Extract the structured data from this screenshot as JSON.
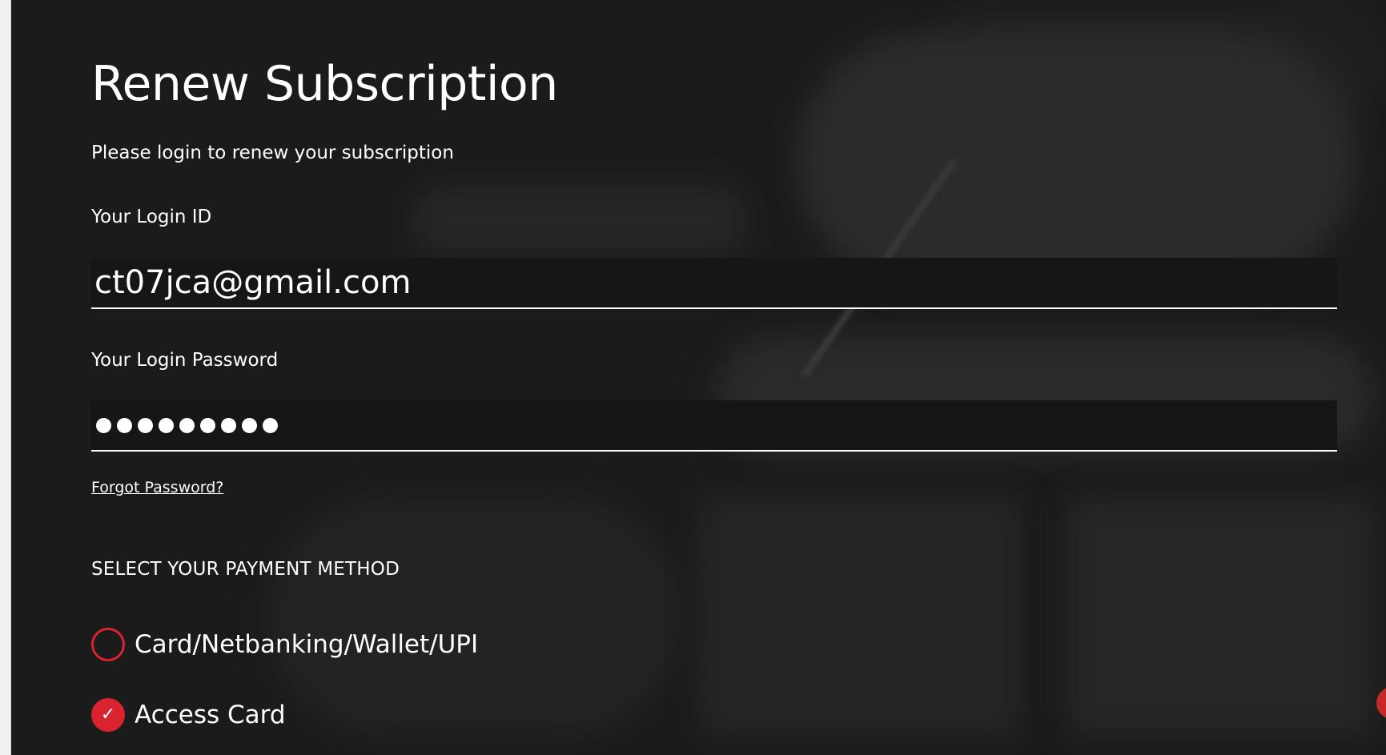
{
  "page": {
    "title": "Renew Subscription",
    "subtitle": "Please login to renew your subscription"
  },
  "login_form": {
    "login_id_label": "Your Login ID",
    "login_id_value": "ct07jca@gmail.com",
    "password_label": "Your Login Password",
    "password_masked_length": 9,
    "forgot_password_link": "Forgot Password?"
  },
  "payment": {
    "heading": "SELECT YOUR PAYMENT METHOD",
    "options": [
      {
        "label": "Card/Netbanking/Wallet/UPI",
        "selected": false
      },
      {
        "label": "Access Card",
        "selected": true
      }
    ]
  },
  "colors": {
    "accent": "#d9232e",
    "text": "#ffffff",
    "panel_background": "#1b1b1b"
  },
  "icons": {
    "selected_check": "check-icon",
    "unselected_radio": "radio-empty-icon"
  }
}
